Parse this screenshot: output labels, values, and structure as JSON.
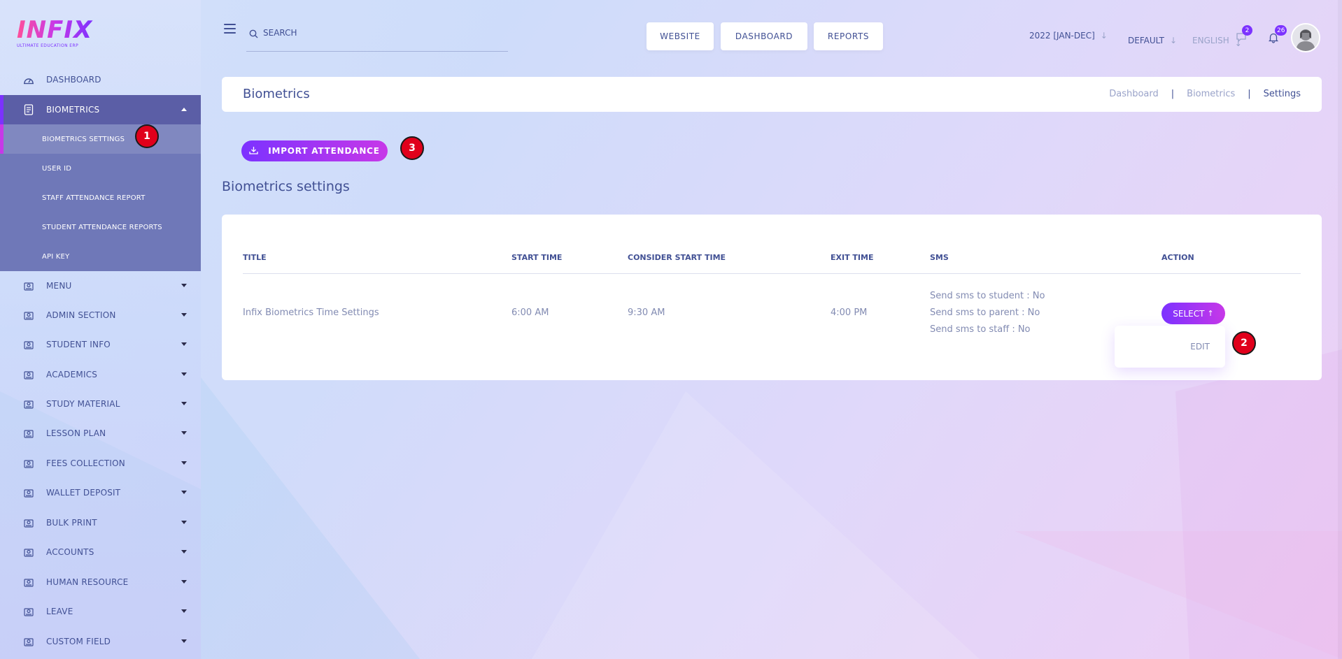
{
  "brand": {
    "logo_text": "INFIX",
    "tagline": "ULTIMATE EDUCATION ERP"
  },
  "sidebar": {
    "items": [
      {
        "label": "DASHBOARD",
        "icon": "dashboard-gauge-icon"
      },
      {
        "label": "BIOMETRICS",
        "icon": "fingerprint-doc-icon"
      },
      {
        "label": "MENU",
        "icon": "user-menu-icon"
      },
      {
        "label": "ADMIN SECTION",
        "icon": "admin-icon"
      },
      {
        "label": "STUDENT INFO",
        "icon": "student-icon"
      },
      {
        "label": "ACADEMICS",
        "icon": "academics-icon"
      },
      {
        "label": "STUDY MATERIAL",
        "icon": "study-material-icon"
      },
      {
        "label": "LESSON PLAN",
        "icon": "lesson-plan-icon"
      },
      {
        "label": "FEES COLLECTION",
        "icon": "fees-icon"
      },
      {
        "label": "WALLET DEPOSIT",
        "icon": "wallet-icon"
      },
      {
        "label": "BULK PRINT",
        "icon": "print-icon"
      },
      {
        "label": "ACCOUNTS",
        "icon": "accounts-icon"
      },
      {
        "label": "HUMAN RESOURCE",
        "icon": "hr-icon"
      },
      {
        "label": "LEAVE",
        "icon": "leave-icon"
      },
      {
        "label": "CUSTOM FIELD",
        "icon": "custom-field-icon"
      }
    ],
    "submenu": [
      "BIOMETRICS SETTINGS",
      "USER ID",
      "STAFF ATTENDANCE REPORT",
      "STUDENT ATTENDANCE REPORTS",
      "API KEY"
    ]
  },
  "header": {
    "search_placeholder": "SEARCH",
    "buttons": {
      "website": "WEBSITE",
      "dashboard": "DASHBOARD",
      "reports": "REPORTS"
    },
    "year": "2022 [JAN-DEC]",
    "theme": "DEFAULT",
    "language": "ENGLISH",
    "messages_count": "2",
    "notifications_count": "26"
  },
  "page": {
    "title": "Biometrics",
    "breadcrumb": [
      "Dashboard",
      "Biometrics",
      "Settings"
    ],
    "import_button": "IMPORT ATTENDANCE",
    "section_title": "Biometrics settings"
  },
  "table": {
    "headers": {
      "title": "TITLE",
      "start_time": "START TIME",
      "consider_start_time": "CONSIDER START TIME",
      "exit_time": "EXIT TIME",
      "sms": "SMS",
      "action": "ACTION"
    },
    "row": {
      "title": "Infix Biometrics Time Settings",
      "start_time": "6:00 AM",
      "consider_start_time": "9:30 AM",
      "exit_time": "4:00 PM",
      "sms": [
        "Send sms to student : No",
        "Send sms to parent : No",
        "Send sms to staff : No"
      ],
      "action_button": "SELECT",
      "action_menu": [
        "EDIT"
      ]
    }
  },
  "markers": [
    "1",
    "2",
    "3"
  ],
  "colors": {
    "primary": "#7c32ff",
    "secondary": "#c738e8",
    "text": "#415094",
    "muted": "#828bb2",
    "sidebar_active": "#5b5ea6",
    "marker": "#e0001b"
  }
}
